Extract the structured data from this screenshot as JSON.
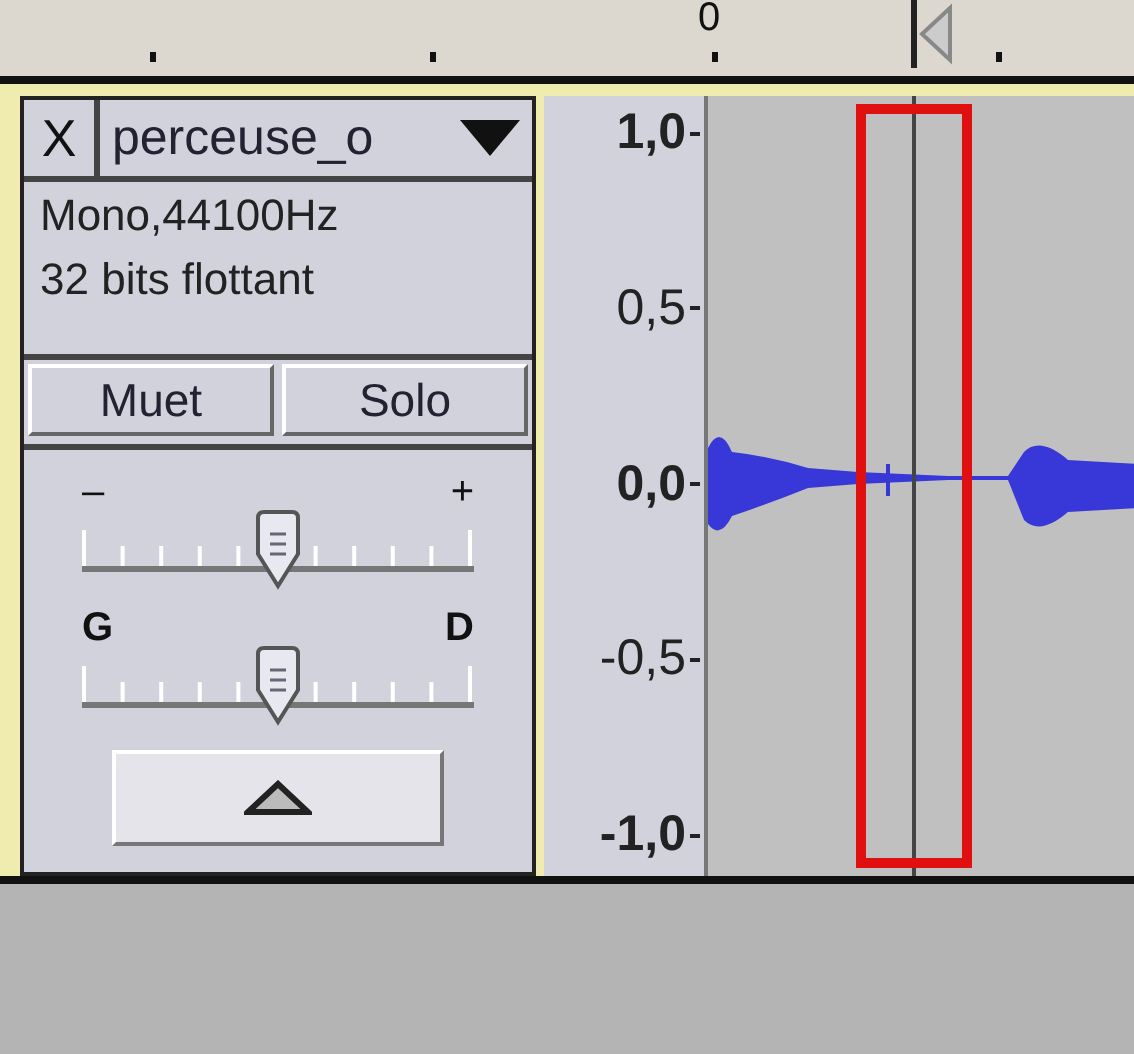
{
  "timeline": {
    "labels": [
      "0"
    ]
  },
  "track": {
    "close": "X",
    "name": "perceuse_o",
    "info": [
      "Mono,44100Hz",
      "32 bits flottant"
    ],
    "buttons": [
      "Muet",
      "Solo"
    ],
    "sliders": [
      {
        "kind": "gain",
        "min_label": "–",
        "max_label": "+",
        "level": 0.5
      },
      {
        "kind": "pan",
        "min_label": "G",
        "max_label": "D",
        "level": 0.5
      }
    ]
  },
  "vertical_ruler": [
    {
      "label": "1,0",
      "kind": "major"
    },
    {
      "label": "0,5",
      "kind": "minor"
    },
    {
      "label": "0,0",
      "kind": "major"
    },
    {
      "label": "-0,5",
      "kind": "minor"
    },
    {
      "label": "-1,0",
      "kind": "major"
    }
  ]
}
